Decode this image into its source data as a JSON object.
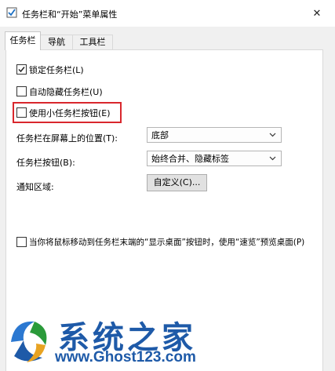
{
  "window": {
    "title": "任务栏和“开始”菜单属性",
    "close_glyph": "✕"
  },
  "tabs": [
    {
      "label": "任务栏",
      "active": true
    },
    {
      "label": "导航",
      "active": false
    },
    {
      "label": "工具栏",
      "active": false
    }
  ],
  "options": {
    "lock_taskbar": {
      "label": "锁定任务栏(L)",
      "checked": true
    },
    "auto_hide": {
      "label": "自动隐藏任务栏(U)",
      "checked": false
    },
    "small_buttons": {
      "label": "使用小任务栏按钮(E)",
      "checked": false
    },
    "peek": {
      "label": "当你将鼠标移动到任务栏末端的“显示桌面”按钮时，使用“速览”预览桌面(P)",
      "checked": false
    }
  },
  "fields": {
    "location": {
      "label": "任务栏在屏幕上的位置(T):",
      "value": "底部"
    },
    "buttons": {
      "label": "任务栏按钮(B):",
      "value": "始终合并、隐藏标签"
    },
    "notify": {
      "label": "通知区域:",
      "button": "自定义(C)..."
    }
  },
  "watermark": {
    "text": "系统之家",
    "url": "www.Ghost123.com"
  },
  "colors": {
    "highlight": "#d9272d",
    "watermark": "#1e5aa8"
  }
}
